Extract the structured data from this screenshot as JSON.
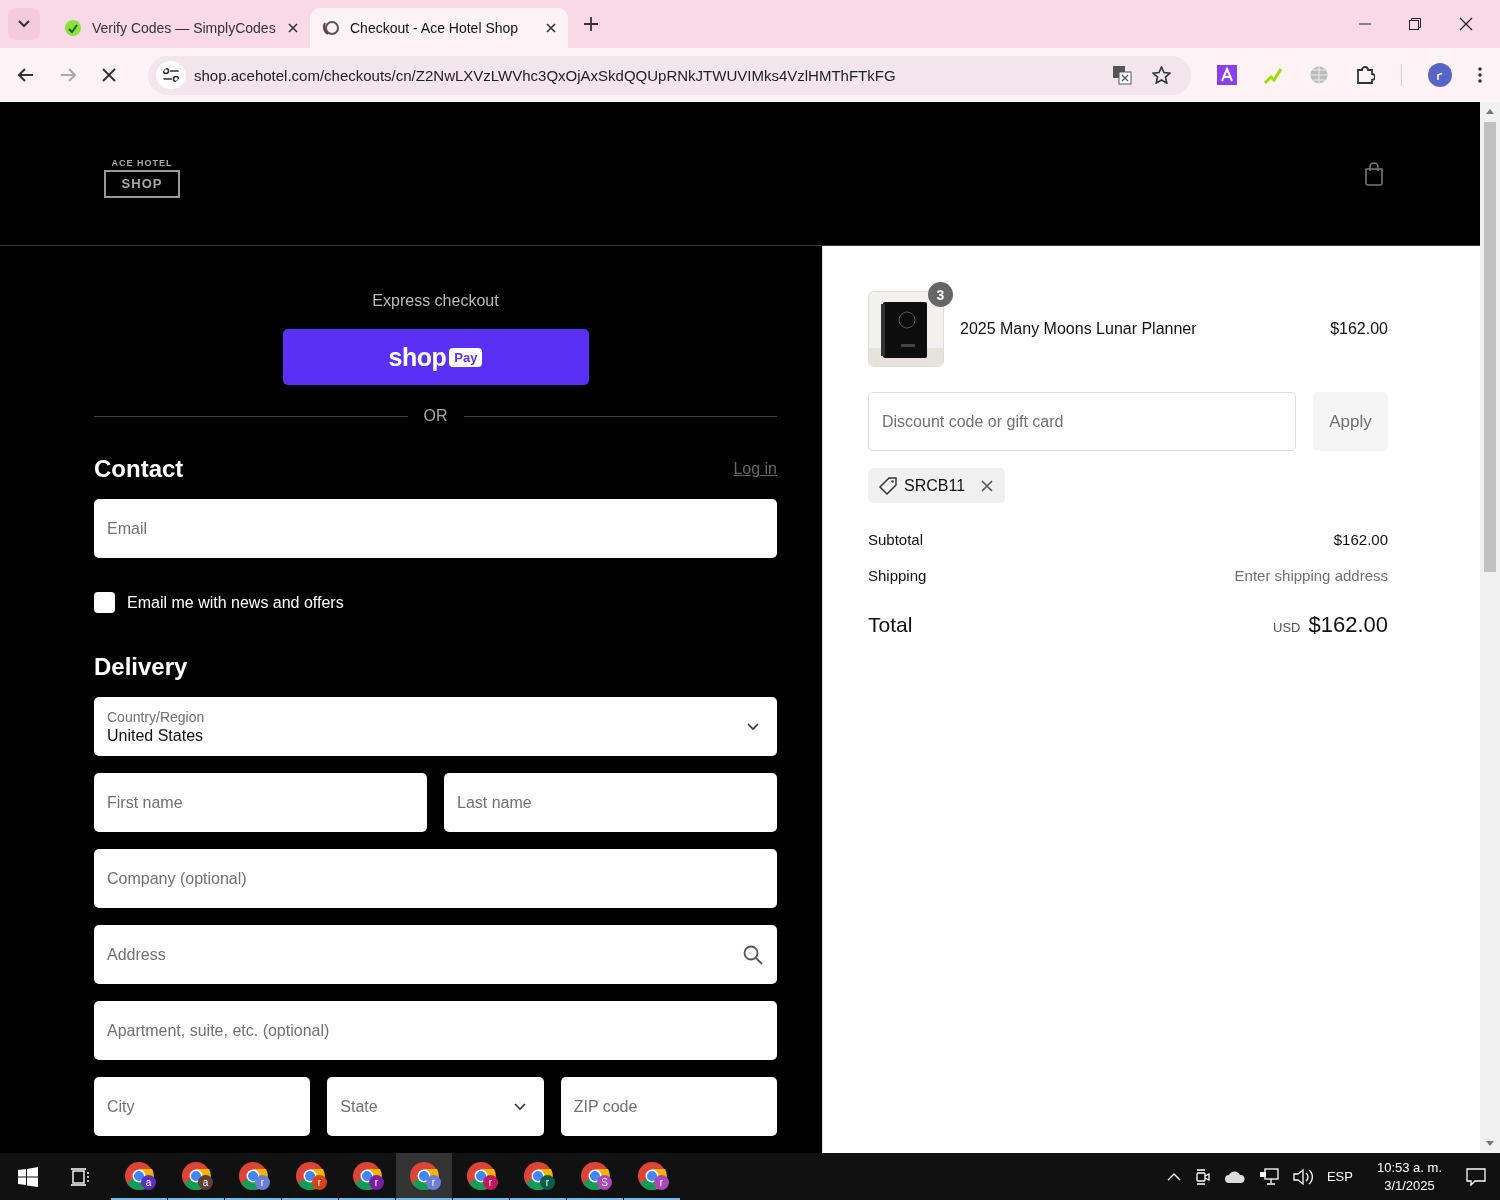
{
  "browser": {
    "tabs": [
      {
        "title": "Verify Codes — SimplyCodes",
        "selected": false
      },
      {
        "title": "Checkout - Ace Hotel Shop",
        "selected": true
      }
    ],
    "url": "shop.acehotel.com/checkouts/cn/Z2NwLXVzLWVhc3QxOjAxSkdQQUpRNkJTWUVIMks4VzlHMThFTkFG",
    "loading": true
  },
  "header": {
    "logo_top": "ACE HOTEL",
    "logo_main": "SHOP"
  },
  "express": {
    "title": "Express checkout",
    "brand": "shop",
    "badge": "Pay",
    "divider": "OR"
  },
  "contact": {
    "heading": "Contact",
    "login_link": "Log in",
    "email": {
      "placeholder": "Email"
    },
    "newsletter": {
      "label": "Email me with news and offers",
      "checked": false
    }
  },
  "delivery": {
    "heading": "Delivery",
    "rows": [
      {
        "fields": [
          {
            "kind": "select",
            "label": "Country/Region",
            "value": "United States"
          }
        ]
      },
      {
        "fields": [
          {
            "kind": "text",
            "placeholder": "First name"
          },
          {
            "kind": "text",
            "placeholder": "Last name"
          }
        ]
      },
      {
        "fields": [
          {
            "kind": "text",
            "placeholder": "Company (optional)"
          }
        ]
      },
      {
        "fields": [
          {
            "kind": "search",
            "placeholder": "Address"
          }
        ]
      },
      {
        "fields": [
          {
            "kind": "text",
            "placeholder": "Apartment, suite, etc. (optional)"
          }
        ]
      },
      {
        "fields": [
          {
            "kind": "text",
            "placeholder": "City"
          },
          {
            "kind": "select",
            "placeholder": "State"
          },
          {
            "kind": "text",
            "placeholder": "ZIP code"
          }
        ]
      }
    ]
  },
  "summary": {
    "item": {
      "quantity": "3",
      "name": "2025 Many Moons Lunar Planner",
      "price": "$162.00"
    },
    "discount": {
      "placeholder": "Discount code or gift card",
      "button": "Apply"
    },
    "applied_code": "SRCB11",
    "lines": [
      {
        "label": "Subtotal",
        "value": "$162.00",
        "kind": "plain"
      },
      {
        "label": "Shipping",
        "value": "Enter shipping address",
        "kind": "muted"
      }
    ],
    "total": {
      "label": "Total",
      "currency": "USD",
      "amount": "$162.00"
    }
  },
  "taskbar": {
    "apps": [
      {
        "letter": "a",
        "color": "#5b2fc0",
        "selected": false
      },
      {
        "letter": "a",
        "color": "#5d4037",
        "selected": false
      },
      {
        "letter": "r",
        "color": "#6b7fd7",
        "selected": false
      },
      {
        "letter": "r",
        "color": "#d84315",
        "selected": false
      },
      {
        "letter": "r",
        "color": "#7b1fa2",
        "selected": false
      },
      {
        "letter": "r",
        "color": "#6b7fd7",
        "selected": true
      },
      {
        "letter": "r",
        "color": "#c2185b",
        "selected": false
      },
      {
        "letter": "r",
        "color": "#0b5e4a",
        "selected": false
      },
      {
        "letter": "S",
        "color": "#ab47bc",
        "selected": false
      },
      {
        "letter": "r",
        "color": "#ab47bc",
        "selected": false
      }
    ],
    "language": "ESP",
    "time": "10:53 a. m.",
    "date": "3/1/2025"
  }
}
